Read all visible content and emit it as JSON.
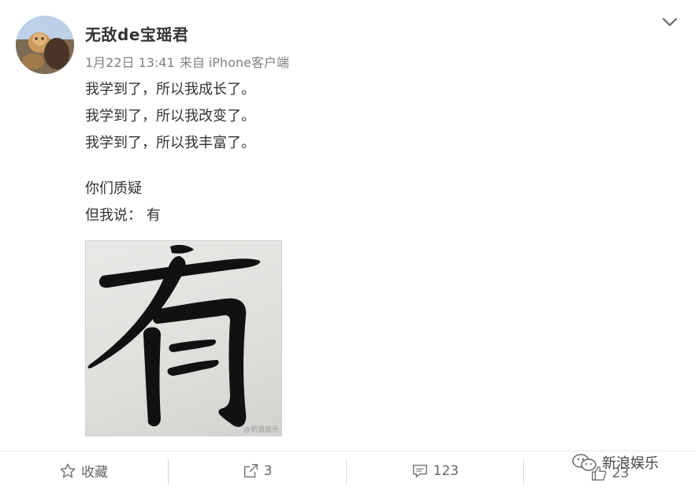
{
  "user": {
    "name": "无敌de宝瑶君",
    "avatar_icon": "avatar-photo"
  },
  "meta": {
    "time": "1月22日 13:41",
    "source": "来自 iPhone客户端"
  },
  "post": {
    "lines": [
      "我学到了，所以我成长了。",
      "我学到了，所以我改变了。",
      "我学到了，所以我丰富了。"
    ],
    "lines2": [
      "你们质疑",
      "但我说： 有"
    ],
    "image_char": "有",
    "image_watermark": "@新浪娱乐"
  },
  "actions": {
    "favorite_label": "收藏",
    "repost_count": "3",
    "comment_count": "123",
    "like_count": "23"
  },
  "watermark_text": "新浪娱乐",
  "colors": {
    "text": "#333333",
    "meta": "#808080",
    "action": "#666666"
  }
}
